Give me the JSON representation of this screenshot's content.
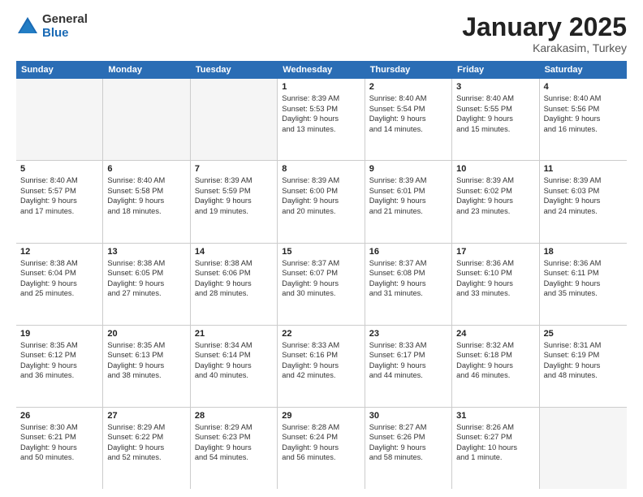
{
  "logo": {
    "general": "General",
    "blue": "Blue"
  },
  "title": "January 2025",
  "subtitle": "Karakasim, Turkey",
  "days": [
    "Sunday",
    "Monday",
    "Tuesday",
    "Wednesday",
    "Thursday",
    "Friday",
    "Saturday"
  ],
  "weeks": [
    [
      {
        "num": "",
        "info": "",
        "empty": true
      },
      {
        "num": "",
        "info": "",
        "empty": true
      },
      {
        "num": "",
        "info": "",
        "empty": true
      },
      {
        "num": "1",
        "info": "Sunrise: 8:39 AM\nSunset: 5:53 PM\nDaylight: 9 hours\nand 13 minutes.",
        "empty": false
      },
      {
        "num": "2",
        "info": "Sunrise: 8:40 AM\nSunset: 5:54 PM\nDaylight: 9 hours\nand 14 minutes.",
        "empty": false
      },
      {
        "num": "3",
        "info": "Sunrise: 8:40 AM\nSunset: 5:55 PM\nDaylight: 9 hours\nand 15 minutes.",
        "empty": false
      },
      {
        "num": "4",
        "info": "Sunrise: 8:40 AM\nSunset: 5:56 PM\nDaylight: 9 hours\nand 16 minutes.",
        "empty": false
      }
    ],
    [
      {
        "num": "5",
        "info": "Sunrise: 8:40 AM\nSunset: 5:57 PM\nDaylight: 9 hours\nand 17 minutes.",
        "empty": false
      },
      {
        "num": "6",
        "info": "Sunrise: 8:40 AM\nSunset: 5:58 PM\nDaylight: 9 hours\nand 18 minutes.",
        "empty": false
      },
      {
        "num": "7",
        "info": "Sunrise: 8:39 AM\nSunset: 5:59 PM\nDaylight: 9 hours\nand 19 minutes.",
        "empty": false
      },
      {
        "num": "8",
        "info": "Sunrise: 8:39 AM\nSunset: 6:00 PM\nDaylight: 9 hours\nand 20 minutes.",
        "empty": false
      },
      {
        "num": "9",
        "info": "Sunrise: 8:39 AM\nSunset: 6:01 PM\nDaylight: 9 hours\nand 21 minutes.",
        "empty": false
      },
      {
        "num": "10",
        "info": "Sunrise: 8:39 AM\nSunset: 6:02 PM\nDaylight: 9 hours\nand 23 minutes.",
        "empty": false
      },
      {
        "num": "11",
        "info": "Sunrise: 8:39 AM\nSunset: 6:03 PM\nDaylight: 9 hours\nand 24 minutes.",
        "empty": false
      }
    ],
    [
      {
        "num": "12",
        "info": "Sunrise: 8:38 AM\nSunset: 6:04 PM\nDaylight: 9 hours\nand 25 minutes.",
        "empty": false
      },
      {
        "num": "13",
        "info": "Sunrise: 8:38 AM\nSunset: 6:05 PM\nDaylight: 9 hours\nand 27 minutes.",
        "empty": false
      },
      {
        "num": "14",
        "info": "Sunrise: 8:38 AM\nSunset: 6:06 PM\nDaylight: 9 hours\nand 28 minutes.",
        "empty": false
      },
      {
        "num": "15",
        "info": "Sunrise: 8:37 AM\nSunset: 6:07 PM\nDaylight: 9 hours\nand 30 minutes.",
        "empty": false
      },
      {
        "num": "16",
        "info": "Sunrise: 8:37 AM\nSunset: 6:08 PM\nDaylight: 9 hours\nand 31 minutes.",
        "empty": false
      },
      {
        "num": "17",
        "info": "Sunrise: 8:36 AM\nSunset: 6:10 PM\nDaylight: 9 hours\nand 33 minutes.",
        "empty": false
      },
      {
        "num": "18",
        "info": "Sunrise: 8:36 AM\nSunset: 6:11 PM\nDaylight: 9 hours\nand 35 minutes.",
        "empty": false
      }
    ],
    [
      {
        "num": "19",
        "info": "Sunrise: 8:35 AM\nSunset: 6:12 PM\nDaylight: 9 hours\nand 36 minutes.",
        "empty": false
      },
      {
        "num": "20",
        "info": "Sunrise: 8:35 AM\nSunset: 6:13 PM\nDaylight: 9 hours\nand 38 minutes.",
        "empty": false
      },
      {
        "num": "21",
        "info": "Sunrise: 8:34 AM\nSunset: 6:14 PM\nDaylight: 9 hours\nand 40 minutes.",
        "empty": false
      },
      {
        "num": "22",
        "info": "Sunrise: 8:33 AM\nSunset: 6:16 PM\nDaylight: 9 hours\nand 42 minutes.",
        "empty": false
      },
      {
        "num": "23",
        "info": "Sunrise: 8:33 AM\nSunset: 6:17 PM\nDaylight: 9 hours\nand 44 minutes.",
        "empty": false
      },
      {
        "num": "24",
        "info": "Sunrise: 8:32 AM\nSunset: 6:18 PM\nDaylight: 9 hours\nand 46 minutes.",
        "empty": false
      },
      {
        "num": "25",
        "info": "Sunrise: 8:31 AM\nSunset: 6:19 PM\nDaylight: 9 hours\nand 48 minutes.",
        "empty": false
      }
    ],
    [
      {
        "num": "26",
        "info": "Sunrise: 8:30 AM\nSunset: 6:21 PM\nDaylight: 9 hours\nand 50 minutes.",
        "empty": false
      },
      {
        "num": "27",
        "info": "Sunrise: 8:29 AM\nSunset: 6:22 PM\nDaylight: 9 hours\nand 52 minutes.",
        "empty": false
      },
      {
        "num": "28",
        "info": "Sunrise: 8:29 AM\nSunset: 6:23 PM\nDaylight: 9 hours\nand 54 minutes.",
        "empty": false
      },
      {
        "num": "29",
        "info": "Sunrise: 8:28 AM\nSunset: 6:24 PM\nDaylight: 9 hours\nand 56 minutes.",
        "empty": false
      },
      {
        "num": "30",
        "info": "Sunrise: 8:27 AM\nSunset: 6:26 PM\nDaylight: 9 hours\nand 58 minutes.",
        "empty": false
      },
      {
        "num": "31",
        "info": "Sunrise: 8:26 AM\nSunset: 6:27 PM\nDaylight: 10 hours\nand 1 minute.",
        "empty": false
      },
      {
        "num": "",
        "info": "",
        "empty": true
      }
    ]
  ]
}
